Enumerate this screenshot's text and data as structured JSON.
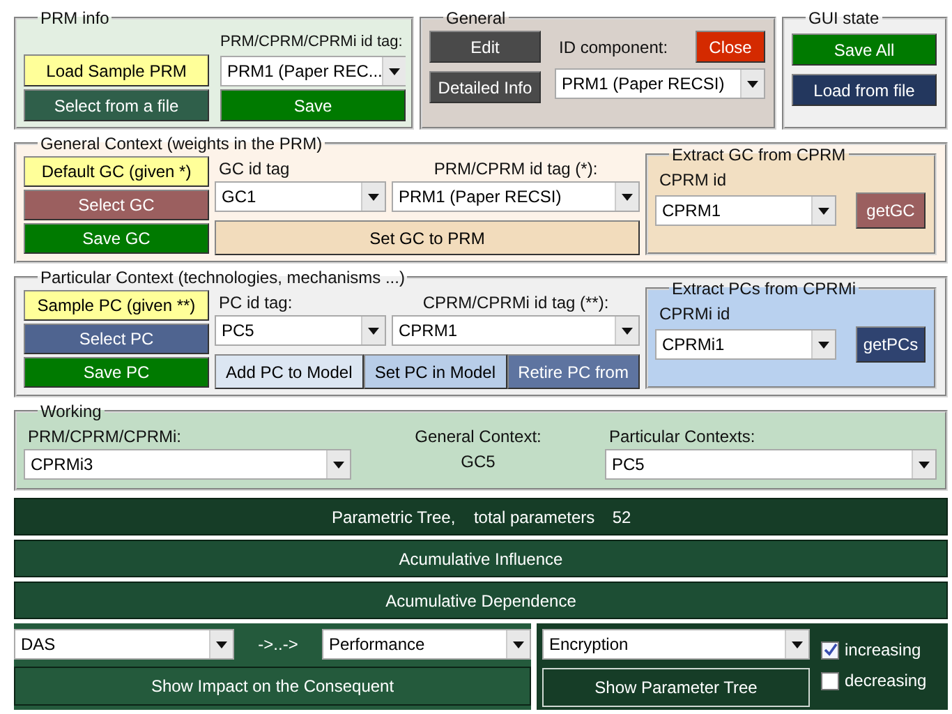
{
  "prm_info": {
    "title": "PRM info",
    "buttons": [
      {
        "label": "Load Sample PRM",
        "color": "#ffff99"
      },
      {
        "label": "Select from a file",
        "color": "#2f5f4a"
      }
    ],
    "tag_label": "PRM/CPRM/CPRMi id tag:",
    "tag_value": "PRM1 (Paper REC...",
    "save_button": "Save"
  },
  "general": {
    "title": "General",
    "buttons": [
      "Edit",
      "Detailed Info"
    ],
    "id_label": "ID component:",
    "close_button": "Close",
    "id_value": "PRM1 (Paper RECSI)"
  },
  "gui_state": {
    "title": "GUI state",
    "buttons": [
      {
        "label": "Save All",
        "color": "#007a00"
      },
      {
        "label": "Load from file",
        "color": "#23375e"
      }
    ]
  },
  "general_context": {
    "title": "General Context (weights in the PRM)",
    "buttons": [
      {
        "label": "Default GC (given *)",
        "color": "#ffff99"
      },
      {
        "label": "Select GC",
        "color": "#9b5f5f"
      },
      {
        "label": "Save GC",
        "color": "#007a00"
      }
    ],
    "tag_label": "GC id tag",
    "tag_value": "GC1",
    "model_label": "PRM/CPRM id tag (*):",
    "model_value": "PRM1 (Paper RECSI)",
    "actions": [
      {
        "label": "Set GC to PRM",
        "color": "#f2dcbc"
      }
    ],
    "extract": {
      "title": "Extract GC from CPRM",
      "id_label": "CPRM id",
      "id_value": "CPRM1",
      "get_button": "getGC",
      "color": "#f2dfc2"
    }
  },
  "particular_context": {
    "title": "Particular Context (technologies, mechanisms ...)",
    "buttons": [
      {
        "label": "Sample PC (given **)",
        "color": "#ffff99"
      },
      {
        "label": "Select PC",
        "color": "#4f6490"
      },
      {
        "label": "Save PC",
        "color": "#007a00"
      }
    ],
    "tag_label": "PC id tag:",
    "tag_value": "PC5",
    "model_label": "CPRM/CPRMi id tag (**):",
    "model_value": "CPRM1",
    "actions": [
      {
        "label": "Add PC to Model",
        "color": "#dce6f2"
      },
      {
        "label": "Set PC in Model",
        "color": "#b8cde8"
      },
      {
        "label": "Retire PC from",
        "color": "#5e74a0"
      }
    ],
    "extract": {
      "title": "Extract PCs from CPRMi",
      "id_label": "CPRMi id",
      "id_value": "CPRMi1",
      "get_button": "getPCs",
      "color": "#b9d1ef"
    }
  },
  "working": {
    "title": "Working",
    "model_label": "PRM/CPRM/CPRMi:",
    "model_value": "CPRMi3",
    "gc_label": "General Context:",
    "gc_value": "GC5",
    "pc_label": "Particular Contexts:",
    "pc_value": "PC5"
  },
  "parametric_tree": {
    "label": "Parametric Tree,",
    "total_label": "total parameters",
    "total": "52"
  },
  "bars": [
    "Acumulative Influence",
    "Acumulative Dependence"
  ],
  "impact": {
    "from": "DAS",
    "arrow": "->..->",
    "to": "Performance",
    "button": "Show Impact on the Consequent"
  },
  "parameter_tree": {
    "value": "Encryption",
    "button": "Show Parameter Tree",
    "options": [
      {
        "label": "increasing",
        "checked": true
      },
      {
        "label": "decreasing",
        "checked": false
      }
    ]
  }
}
